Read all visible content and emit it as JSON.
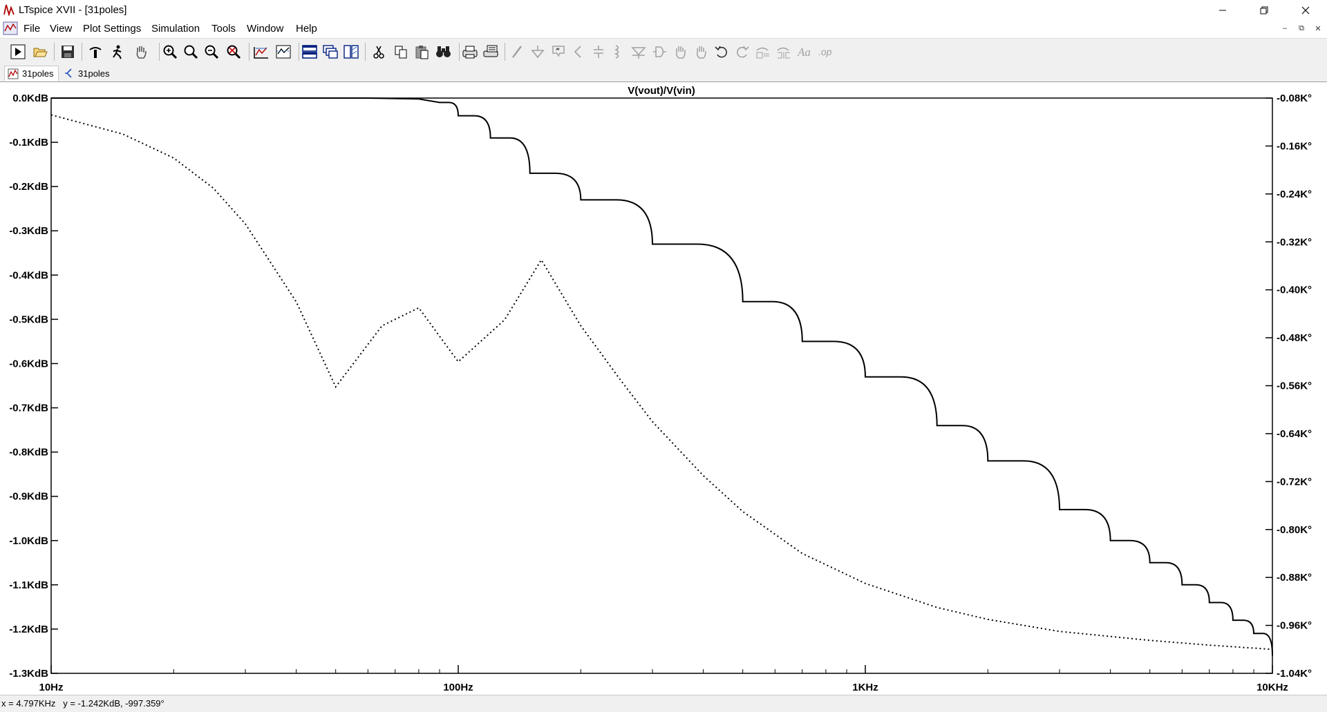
{
  "window": {
    "title": "LTspice XVII - [31poles]",
    "controls": [
      "minimize",
      "maximize",
      "close"
    ]
  },
  "menu": {
    "items": [
      {
        "id": "file",
        "label": "File"
      },
      {
        "id": "view",
        "label": "View"
      },
      {
        "id": "plot-settings",
        "label": "Plot Settings"
      },
      {
        "id": "simulation",
        "label": "Simulation"
      },
      {
        "id": "tools",
        "label": "Tools"
      },
      {
        "id": "window",
        "label": "Window"
      },
      {
        "id": "help",
        "label": "Help"
      }
    ]
  },
  "toolbar": {
    "buttons": [
      "run-icon",
      "open-icon",
      "save-icon",
      "control-panel-icon",
      "halt-icon",
      "pan-hand-icon",
      "zoom-in-icon",
      "zoom-fit-icon",
      "zoom-out-icon",
      "zoom-cancel-icon",
      "autorange-icon",
      "pick-visible-traces-icon",
      "tile-horizontal-icon",
      "cascade-icon",
      "tile-vertical-icon",
      "cut-icon",
      "copy-icon",
      "paste-icon",
      "find-icon",
      "print-icon",
      "print-preview-icon",
      "wire-icon",
      "ground-icon",
      "label-net-icon",
      "resistor-icon",
      "capacitor-icon",
      "inductor-icon",
      "diode-icon",
      "component-icon",
      "move-icon",
      "drag-icon",
      "undo-icon",
      "redo-icon",
      "rotate-icon",
      "mirror-icon",
      "text-icon",
      "spice-directive-icon"
    ]
  },
  "tabs": [
    {
      "label": "31poles",
      "kind": "waveform",
      "active": true
    },
    {
      "label": "31poles",
      "kind": "schematic",
      "active": false
    }
  ],
  "plot": {
    "title": "V(vout)/V(vin)",
    "left_axis_labels": [
      "0.0KdB",
      "-0.1KdB",
      "-0.2KdB",
      "-0.3KdB",
      "-0.4KdB",
      "-0.5KdB",
      "-0.6KdB",
      "-0.7KdB",
      "-0.8KdB",
      "-0.9KdB",
      "-1.0KdB",
      "-1.1KdB",
      "-1.2KdB",
      "-1.3KdB"
    ],
    "right_axis_labels": [
      "-0.08K°",
      "-0.16K°",
      "-0.24K°",
      "-0.32K°",
      "-0.40K°",
      "-0.48K°",
      "-0.56K°",
      "-0.64K°",
      "-0.72K°",
      "-0.80K°",
      "-0.88K°",
      "-0.96K°",
      "-1.04K°"
    ],
    "x_axis_labels": [
      "10Hz",
      "100Hz",
      "1KHz",
      "10KHz"
    ]
  },
  "chart_data": {
    "type": "line",
    "title": "V(vout)/V(vin)",
    "x_scale": "log",
    "xlim": [
      10,
      10000
    ],
    "ylim_left": [
      -1.3,
      0.0
    ],
    "ylim_left_unit": "KdB",
    "ylim_right": [
      -1.04,
      -0.08
    ],
    "ylim_right_unit": "K°",
    "grid": false,
    "series": [
      {
        "axis": "left",
        "style": "solid",
        "x": [
          10,
          20,
          40,
          60,
          80,
          90,
          100,
          120,
          150,
          200,
          300,
          500,
          700,
          1000,
          1500,
          2000,
          3000,
          4000,
          5000,
          6000,
          7000,
          8000,
          9000,
          10000
        ],
        "y": [
          0.0,
          0.0,
          0.0,
          0.0,
          -0.002,
          -0.01,
          -0.04,
          -0.09,
          -0.17,
          -0.23,
          -0.33,
          -0.46,
          -0.55,
          -0.63,
          -0.74,
          -0.82,
          -0.93,
          -1.0,
          -1.05,
          -1.1,
          -1.14,
          -1.18,
          -1.21,
          -1.26
        ]
      },
      {
        "axis": "right",
        "style": "dotted",
        "x": [
          10,
          15,
          20,
          25,
          30,
          40,
          50,
          65,
          80,
          100,
          130,
          160,
          200,
          250,
          300,
          400,
          500,
          700,
          1000,
          1500,
          2000,
          3000,
          5000,
          7000,
          10000
        ],
        "y": [
          -0.108,
          -0.14,
          -0.18,
          -0.23,
          -0.29,
          -0.42,
          -0.562,
          -0.46,
          -0.43,
          -0.52,
          -0.45,
          -0.35,
          -0.46,
          -0.55,
          -0.62,
          -0.71,
          -0.77,
          -0.84,
          -0.89,
          -0.93,
          -0.95,
          -0.97,
          -0.985,
          -0.993,
          -1.0
        ]
      }
    ]
  },
  "status": {
    "readout": "x = 4.797KHz   y = -1.242KdB, -997.359°"
  }
}
